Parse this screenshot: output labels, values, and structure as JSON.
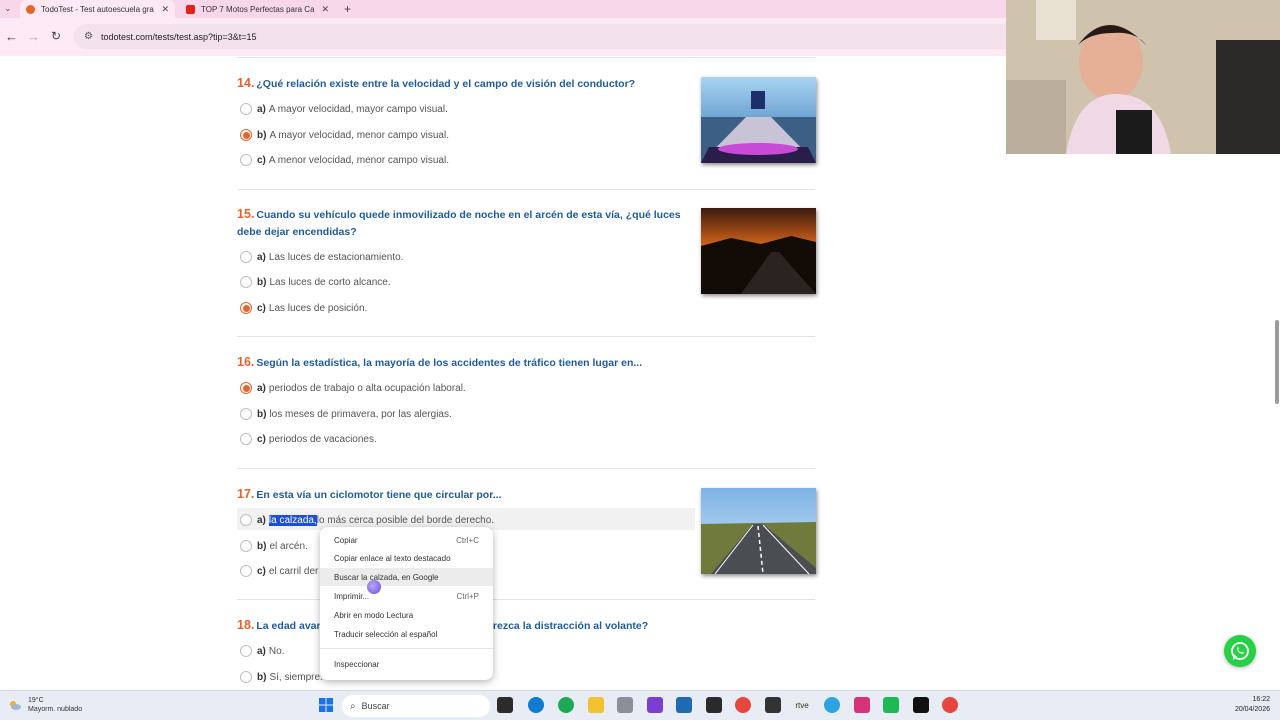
{
  "browser": {
    "tabs": [
      {
        "title": "TodoTest - Test autoescuela gra",
        "active": true
      },
      {
        "title": "TOP 7 Motos Perfectas para Ca",
        "active": false
      }
    ],
    "url": "todotest.com/tests/test.asp?tip=3&t=15"
  },
  "questions": [
    {
      "number": "14.",
      "text": "¿Qué relación existe entre la velocidad y el campo de visión del conductor?",
      "options": [
        {
          "letter": "a)",
          "text": "A mayor velocidad, mayor campo visual.",
          "checked": false
        },
        {
          "letter": "b)",
          "text": "A mayor velocidad, menor campo visual.",
          "checked": true
        },
        {
          "letter": "c)",
          "text": "A menor velocidad, menor campo visual.",
          "checked": false
        }
      ]
    },
    {
      "number": "15.",
      "text": "Cuando su vehículo quede inmovilizado de noche en el arcén de esta vía, ¿qué luces debe dejar encendidas?",
      "options": [
        {
          "letter": "a)",
          "text": "Las luces de estacionamiento.",
          "checked": false
        },
        {
          "letter": "b)",
          "text": "Las luces de corto alcance.",
          "checked": false
        },
        {
          "letter": "c)",
          "text": "Las luces de posición.",
          "checked": true
        }
      ]
    },
    {
      "number": "16.",
      "text": "Según la estadística, la mayoría de los accidentes de tráfico tienen lugar en...",
      "options": [
        {
          "letter": "a)",
          "text": "periodos de trabajo o alta ocupación laboral.",
          "checked": true
        },
        {
          "letter": "b)",
          "text": "los meses de primavera, por las alergias.",
          "checked": false
        },
        {
          "letter": "c)",
          "text": "periodos de vacaciones.",
          "checked": false
        }
      ]
    },
    {
      "number": "17.",
      "text": "En esta vía un ciclomotor tiene que circular por...",
      "options": [
        {
          "letter": "a)",
          "selected": "la calzada,",
          "text": " lo más cerca posible del borde derecho.",
          "checked": false
        },
        {
          "letter": "b)",
          "text": "el arcén.",
          "checked": false
        },
        {
          "letter": "c)",
          "text": "el carril der",
          "checked": false
        }
      ]
    },
    {
      "number": "18.",
      "text_start": "La edad avan",
      "text_end": "rezca la distracción al volante?",
      "options": [
        {
          "letter": "a)",
          "text": "No.",
          "checked": false
        },
        {
          "letter": "b)",
          "text": "Sí, siempre.",
          "checked": false
        }
      ]
    }
  ],
  "context_menu": {
    "items": [
      {
        "label": "Copiar",
        "shortcut": "Ctrl+C"
      },
      {
        "label": "Copiar enlace al texto destacado",
        "shortcut": ""
      },
      {
        "label": "Buscar la calzada, en Google",
        "shortcut": ""
      },
      {
        "label": "Imprimir...",
        "shortcut": "Ctrl+P"
      },
      {
        "label": "Abrir en modo Lectura",
        "shortcut": ""
      },
      {
        "label": "Traducir selección al español",
        "shortcut": ""
      },
      {
        "label": "Inspeccionar",
        "shortcut": ""
      }
    ]
  },
  "taskbar": {
    "weather_temp": "19°C",
    "weather_desc": "Mayorm. nublado",
    "search_placeholder": "Buscar",
    "time": "16:22",
    "date": "20/04/2026"
  },
  "colors": {
    "question_number": "#e8632a",
    "question_text": "#1e5b9b",
    "radio_checked": "#e8632a",
    "selection": "#1a4fd6"
  }
}
